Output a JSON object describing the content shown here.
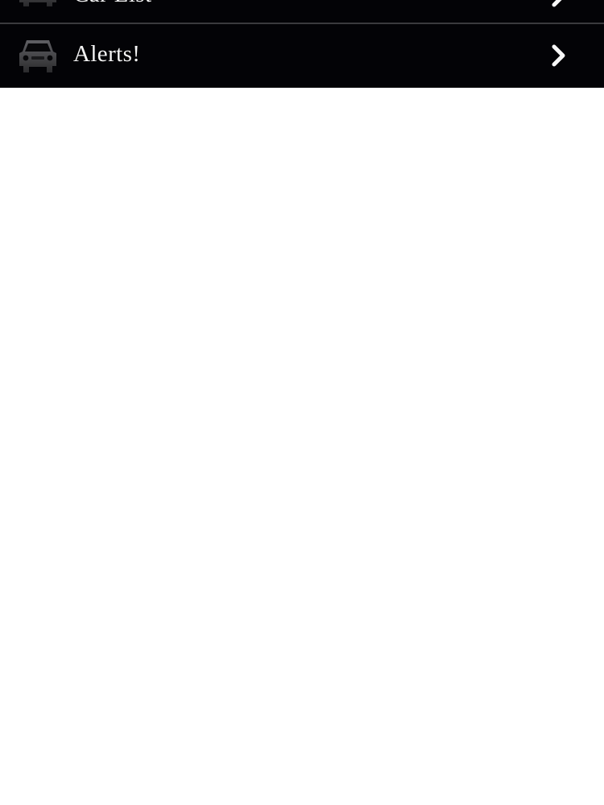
{
  "menu": {
    "items": [
      {
        "label": "Car List",
        "icon": "car-icon"
      },
      {
        "label": "Alerts!",
        "icon": "car-icon"
      }
    ]
  },
  "colors": {
    "menu_background": "#030306",
    "text": "#f4f4f4",
    "divider": "#3a3a3d",
    "page_background": "#ffffff"
  }
}
